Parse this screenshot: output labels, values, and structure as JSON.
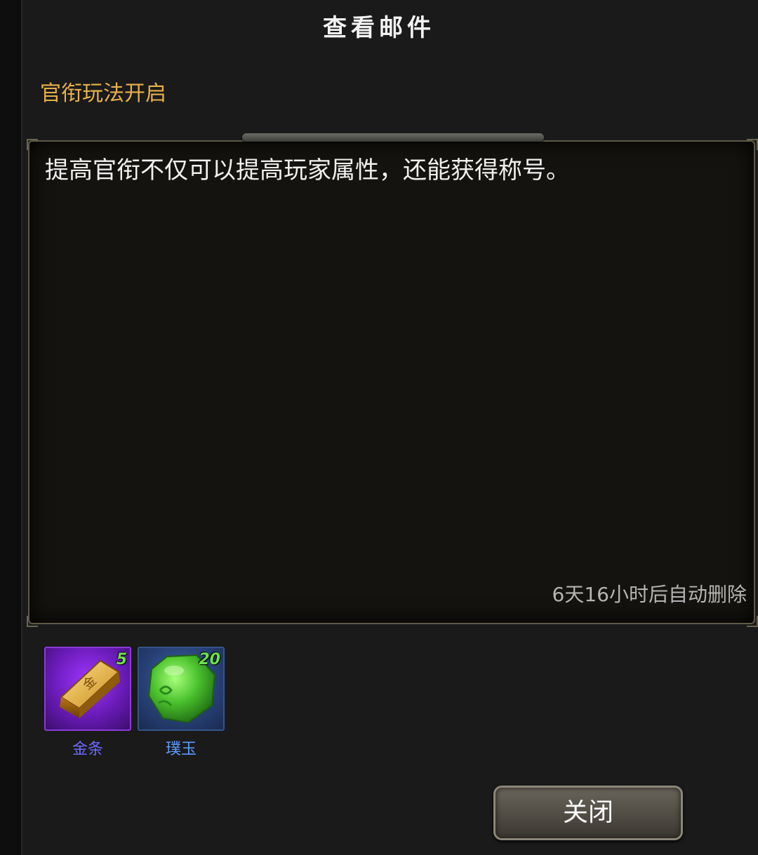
{
  "window": {
    "title": "查看邮件"
  },
  "mail": {
    "subject": "官衔玩法开启",
    "body": "提高官衔不仅可以提高玩家属性，还能获得称号。",
    "expire_text": "6天16小时后自动删除"
  },
  "attachments": [
    {
      "name": "金条",
      "count": "5",
      "rarity_color": "#8c3ad8",
      "icon": "gold-bar-icon"
    },
    {
      "name": "璞玉",
      "count": "20",
      "rarity_color": "#34558c",
      "icon": "jade-gem-icon"
    }
  ],
  "buttons": {
    "close_label": "关闭"
  }
}
